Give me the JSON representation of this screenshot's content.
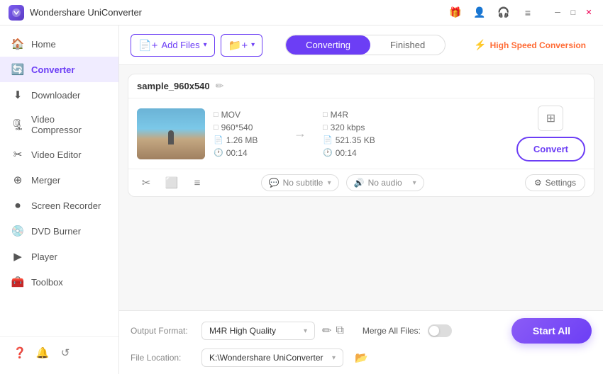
{
  "app": {
    "title": "Wondershare UniConverter"
  },
  "titlebar": {
    "logo_alt": "Wondershare Logo",
    "icons": [
      "gift",
      "user",
      "headset",
      "menu",
      "minimize",
      "maximize",
      "close"
    ]
  },
  "sidebar": {
    "items": [
      {
        "id": "home",
        "label": "Home",
        "icon": "🏠"
      },
      {
        "id": "converter",
        "label": "Converter",
        "icon": "🔄"
      },
      {
        "id": "downloader",
        "label": "Downloader",
        "icon": "⬇"
      },
      {
        "id": "video-compressor",
        "label": "Video Compressor",
        "icon": "🗜"
      },
      {
        "id": "video-editor",
        "label": "Video Editor",
        "icon": "✂"
      },
      {
        "id": "merger",
        "label": "Merger",
        "icon": "⊕"
      },
      {
        "id": "screen-recorder",
        "label": "Screen Recorder",
        "icon": "⏺"
      },
      {
        "id": "dvd-burner",
        "label": "DVD Burner",
        "icon": "💿"
      },
      {
        "id": "player",
        "label": "Player",
        "icon": "▶"
      },
      {
        "id": "toolbox",
        "label": "Toolbox",
        "icon": "🧰"
      }
    ],
    "bottom_icons": [
      "help",
      "bell",
      "refresh"
    ]
  },
  "toolbar": {
    "add_files_label": "Add Files",
    "add_files_dropdown": true,
    "add_folder_label": "Add Folder",
    "tabs": [
      {
        "id": "converting",
        "label": "Converting",
        "active": true
      },
      {
        "id": "finished",
        "label": "Finished"
      }
    ],
    "high_speed_label": "High Speed Conversion"
  },
  "file_card": {
    "filename": "sample_960x540",
    "source": {
      "format": "MOV",
      "resolution": "960*540",
      "size": "1.26 MB",
      "duration": "00:14"
    },
    "output": {
      "format": "M4R",
      "bitrate": "320 kbps",
      "size": "521.35 KB",
      "duration": "00:14"
    },
    "subtitle_label": "No subtitle",
    "audio_label": "No audio",
    "settings_label": "Settings",
    "convert_label": "Convert"
  },
  "bottom": {
    "output_format_label": "Output Format:",
    "output_format_value": "M4R High Quality",
    "file_location_label": "File Location:",
    "file_location_value": "K:\\Wondershare UniConverter",
    "merge_all_files_label": "Merge All Files:",
    "merge_toggle": false,
    "start_all_label": "Start All"
  }
}
